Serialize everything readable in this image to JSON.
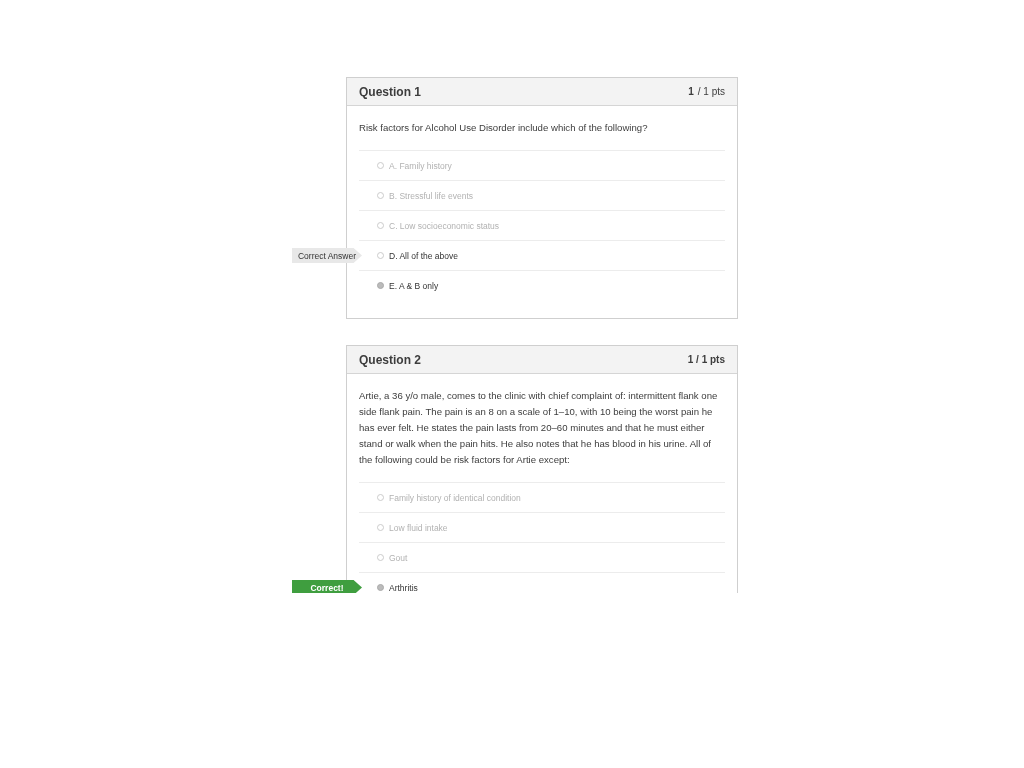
{
  "questions": [
    {
      "title": "Question 1",
      "score": "1",
      "total": "/ 1 pts",
      "prompt": "Risk factors for Alcohol Use Disorder include which of the following?",
      "options": [
        {
          "label": "A. Family history",
          "selected": false,
          "dimmed": true
        },
        {
          "label": "B. Stressful life events",
          "selected": false,
          "dimmed": true
        },
        {
          "label": "C. Low socioeconomic status",
          "selected": false,
          "dimmed": true
        },
        {
          "label": "D. All of the above",
          "selected": false,
          "dimmed": false,
          "flag": {
            "kind": "correct_answer",
            "text": "Correct Answer"
          }
        },
        {
          "label": "E. A & B only",
          "selected": true,
          "dimmed": false
        }
      ]
    },
    {
      "title": "Question 2",
      "score": "1 / 1 pts",
      "prompt": "Artie, a 36 y/o male, comes to the clinic with chief complaint of: intermittent flank one side flank pain. The pain is an 8 on a scale of 1–10, with 10 being the worst pain he has ever felt. He states the pain lasts from 20–60 minutes and that he must either stand or walk when the pain hits. He also notes that he has blood in his urine. All of the following could be risk factors for Artie except:",
      "options": [
        {
          "label": "Family history of identical condition",
          "selected": false,
          "dimmed": true
        },
        {
          "label": "Low fluid intake",
          "selected": false,
          "dimmed": true
        },
        {
          "label": "Gout",
          "selected": false,
          "dimmed": true
        },
        {
          "label": "Arthritis",
          "selected": true,
          "dimmed": false,
          "flag": {
            "kind": "correct",
            "text": "Correct!"
          }
        }
      ]
    }
  ]
}
